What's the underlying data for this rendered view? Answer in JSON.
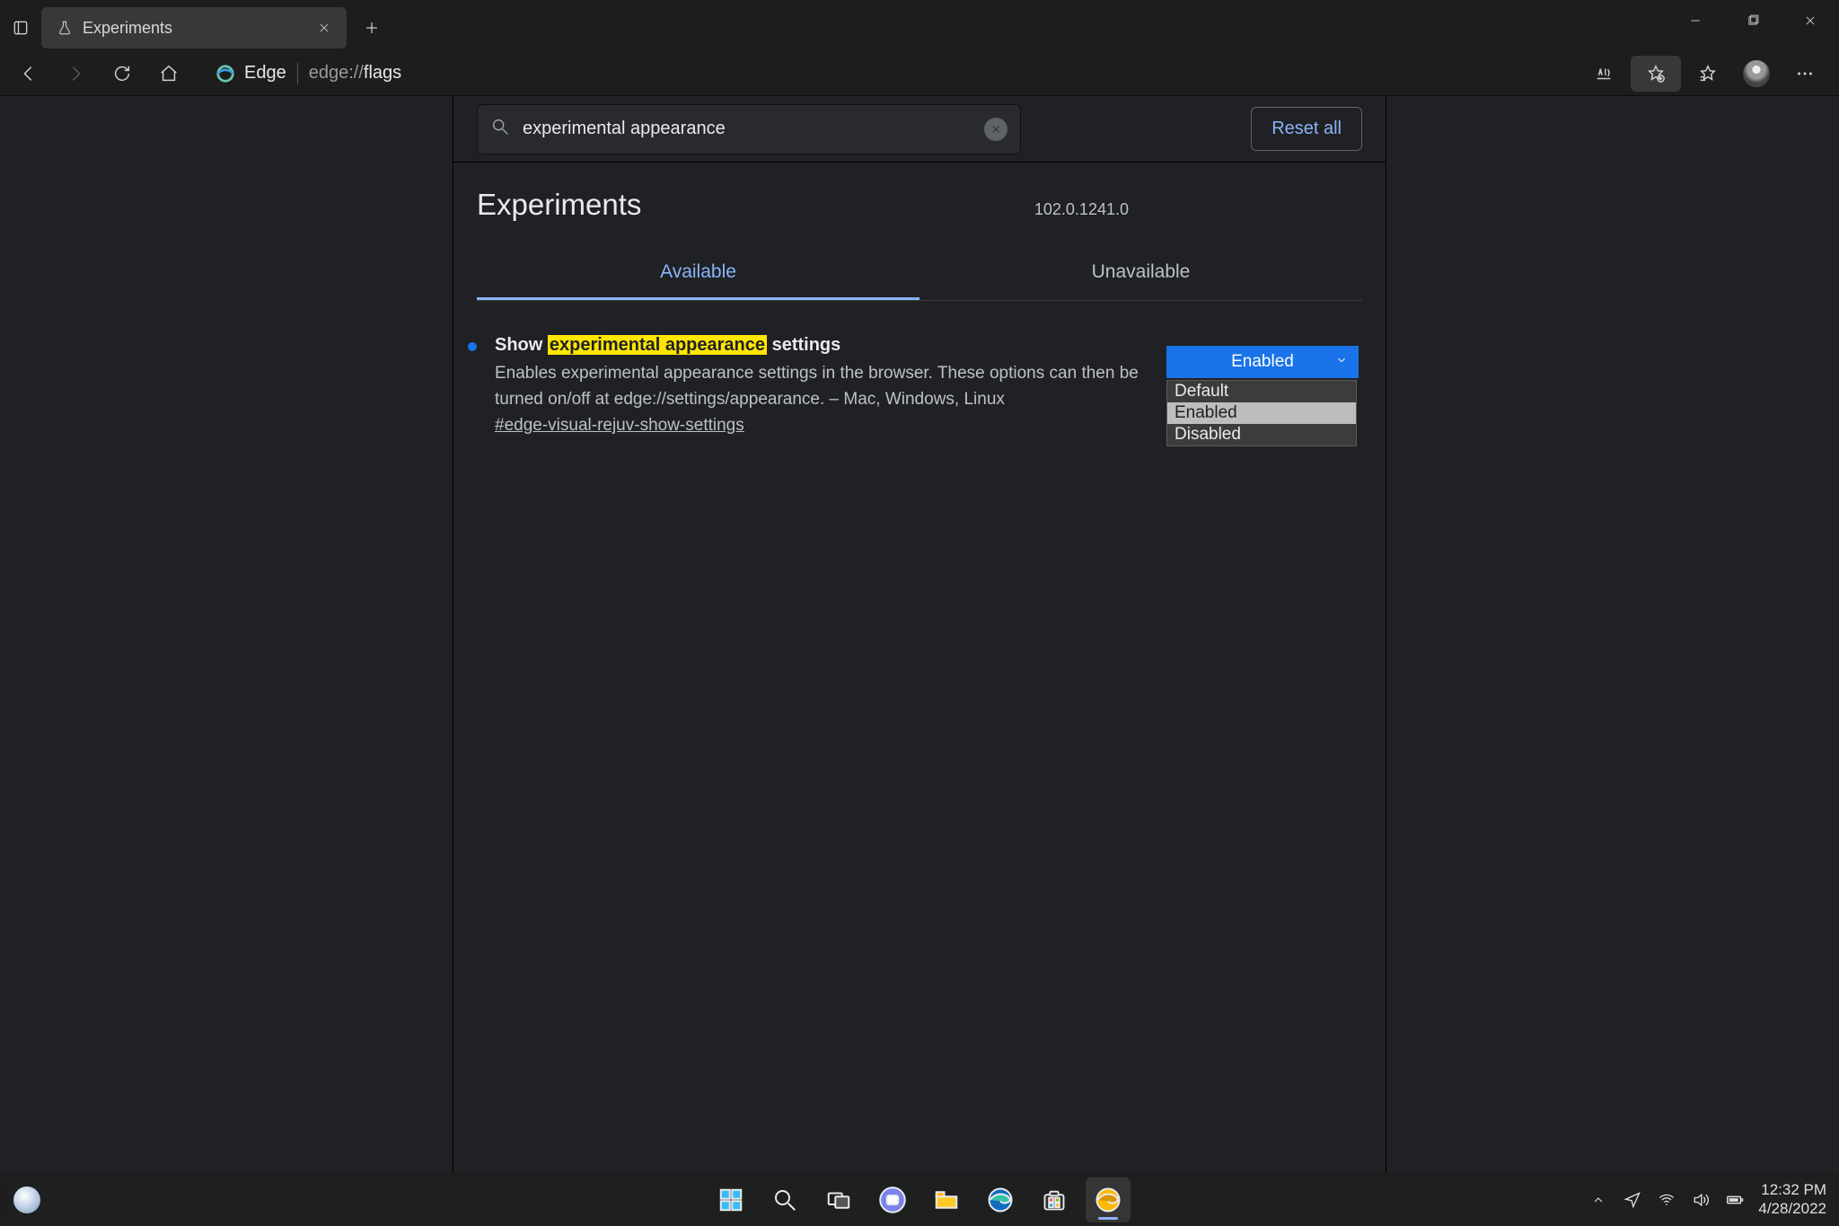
{
  "window": {
    "tab_title": "Experiments",
    "url_scheme": "edge://",
    "url_path": "flags",
    "edge_label": "Edge"
  },
  "page": {
    "search_value": "experimental appearance",
    "reset_label": "Reset all",
    "title": "Experiments",
    "version": "102.0.1241.0",
    "tabs": {
      "available": "Available",
      "unavailable": "Unavailable"
    }
  },
  "flag": {
    "title_pre": "Show ",
    "title_highlight": "experimental appearance",
    "title_post": " settings",
    "description": "Enables experimental appearance settings in the browser. These options can then be turned on/off at edge://settings/appearance. – Mac, Windows, Linux",
    "anchor": "#edge-visual-rejuv-show-settings",
    "dropdown": {
      "selected": "Enabled",
      "options": {
        "default": "Default",
        "enabled": "Enabled",
        "disabled": "Disabled"
      }
    }
  },
  "system": {
    "time": "12:32 PM",
    "date": "4/28/2022"
  }
}
